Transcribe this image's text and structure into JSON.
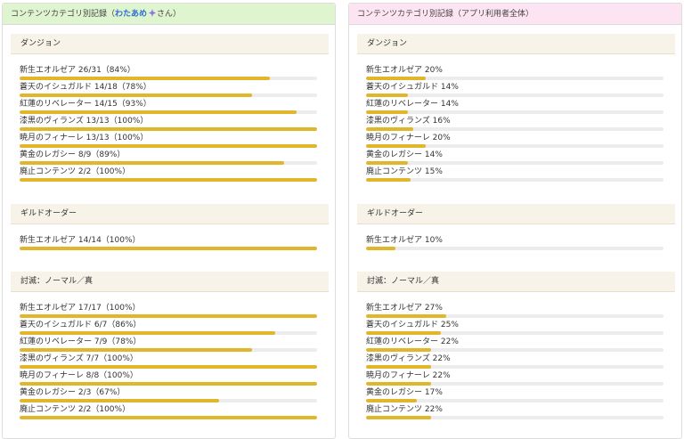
{
  "colors": {
    "bar_fill": "#e2b62a",
    "bar_track": "#ececec",
    "owner_link": "#2f6fd1"
  },
  "left": {
    "header": {
      "prefix": "コンテンツカテゴリ別記録（",
      "owner": "わたあめ",
      "owner_icon": "sparkle-avatar-icon",
      "suffix": "さん）"
    },
    "sections": [
      {
        "title": "ダンジョン",
        "items": [
          {
            "label": "新生エオルゼア 26/31（84%）",
            "ratio": 0.84
          },
          {
            "label": "蒼天のイシュガルド 14/18（78%）",
            "ratio": 0.78
          },
          {
            "label": "紅蓮のリベレーター 14/15（93%）",
            "ratio": 0.93
          },
          {
            "label": "漆黒のヴィランズ 13/13（100%）",
            "ratio": 1.0
          },
          {
            "label": "暁月のフィナーレ 13/13（100%）",
            "ratio": 1.0
          },
          {
            "label": "黄金のレガシー 8/9（89%）",
            "ratio": 0.89
          },
          {
            "label": "廃止コンテンツ 2/2（100%）",
            "ratio": 1.0
          }
        ]
      },
      {
        "title": "ギルドオーダー",
        "items": [
          {
            "label": "新生エオルゼア 14/14（100%）",
            "ratio": 1.0
          }
        ]
      },
      {
        "title": "討滅：ノーマル／真",
        "items": [
          {
            "label": "新生エオルゼア 17/17（100%）",
            "ratio": 1.0
          },
          {
            "label": "蒼天のイシュガルド 6/7（86%）",
            "ratio": 0.86
          },
          {
            "label": "紅蓮のリベレーター 7/9（78%）",
            "ratio": 0.78
          },
          {
            "label": "漆黒のヴィランズ 7/7（100%）",
            "ratio": 1.0
          },
          {
            "label": "暁月のフィナーレ 8/8（100%）",
            "ratio": 1.0
          },
          {
            "label": "黄金のレガシー 2/3（67%）",
            "ratio": 0.67
          },
          {
            "label": "廃止コンテンツ 2/2（100%）",
            "ratio": 1.0
          }
        ]
      }
    ]
  },
  "right": {
    "header": {
      "title": "コンテンツカテゴリ別記録（アプリ利用者全体）"
    },
    "sections": [
      {
        "title": "ダンジョン",
        "items": [
          {
            "label": "新生エオルゼア 20%",
            "ratio": 0.2
          },
          {
            "label": "蒼天のイシュガルド 14%",
            "ratio": 0.14
          },
          {
            "label": "紅蓮のリベレーター 14%",
            "ratio": 0.14
          },
          {
            "label": "漆黒のヴィランズ 16%",
            "ratio": 0.16
          },
          {
            "label": "暁月のフィナーレ 20%",
            "ratio": 0.2
          },
          {
            "label": "黄金のレガシー 14%",
            "ratio": 0.14
          },
          {
            "label": "廃止コンテンツ 15%",
            "ratio": 0.15
          }
        ]
      },
      {
        "title": "ギルドオーダー",
        "items": [
          {
            "label": "新生エオルゼア 10%",
            "ratio": 0.1
          }
        ]
      },
      {
        "title": "討滅：ノーマル／真",
        "items": [
          {
            "label": "新生エオルゼア 27%",
            "ratio": 0.27
          },
          {
            "label": "蒼天のイシュガルド 25%",
            "ratio": 0.25
          },
          {
            "label": "紅蓮のリベレーター 22%",
            "ratio": 0.22
          },
          {
            "label": "漆黒のヴィランズ 22%",
            "ratio": 0.22
          },
          {
            "label": "暁月のフィナーレ 22%",
            "ratio": 0.22
          },
          {
            "label": "黄金のレガシー 17%",
            "ratio": 0.17
          },
          {
            "label": "廃止コンテンツ 22%",
            "ratio": 0.22
          }
        ]
      }
    ]
  }
}
